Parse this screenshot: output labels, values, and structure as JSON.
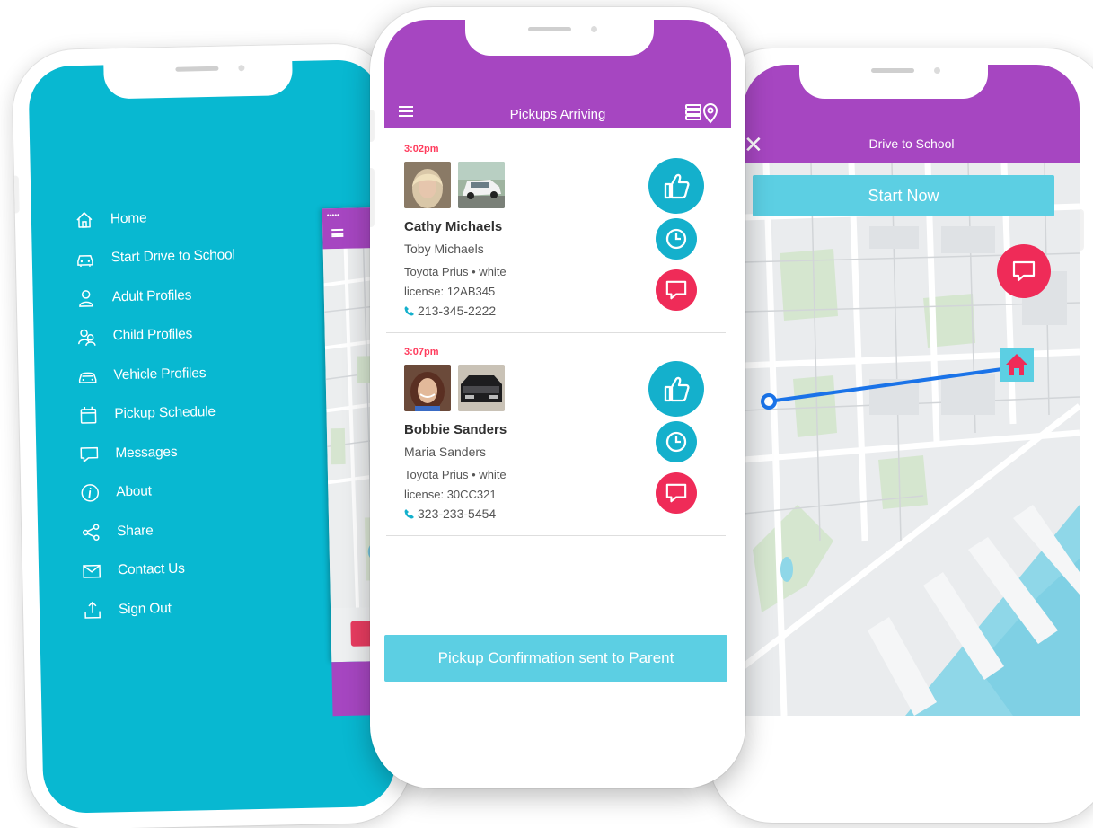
{
  "colors": {
    "teal": "#08b8d1",
    "purple": "#a646c1",
    "red_time": "#ff3d5e",
    "action_blue": "#14b0cc",
    "action_red": "#ef2b58",
    "button_light_blue": "#5ccfe3"
  },
  "left_phone": {
    "menu": [
      {
        "label": "Home",
        "icon": "home-icon"
      },
      {
        "label": "Start Drive to School",
        "icon": "car-front-icon"
      },
      {
        "label": "Adult Profiles",
        "icon": "person-icon"
      },
      {
        "label": "Child Profiles",
        "icon": "people-icon"
      },
      {
        "label": "Vehicle Profiles",
        "icon": "vehicle-icon"
      },
      {
        "label": "Pickup Schedule",
        "icon": "calendar-icon"
      },
      {
        "label": "Messages",
        "icon": "chat-icon"
      },
      {
        "label": "About",
        "icon": "info-icon"
      },
      {
        "label": "Share",
        "icon": "share-icon"
      },
      {
        "label": "Contact Us",
        "icon": "envelope-icon"
      },
      {
        "label": "Sign Out",
        "icon": "sign-out-icon"
      }
    ]
  },
  "center_phone": {
    "title": "Pickups Arriving",
    "pickups": [
      {
        "time": "3:02pm",
        "name": "Cathy Michaels",
        "child": "Toby Michaels",
        "car": "Toyota Prius • white",
        "license": "license: 12AB345",
        "phone": "213-345-2222"
      },
      {
        "time": "3:07pm",
        "name": "Bobbie Sanders",
        "child": "Maria Sanders",
        "car": "Toyota Prius • white",
        "license": "license: 30CC321",
        "phone": "323-233-5454"
      }
    ],
    "confirmation": "Pickup Confirmation sent to Parent"
  },
  "right_phone": {
    "title": "Drive to School",
    "start_button": "Start Now"
  }
}
